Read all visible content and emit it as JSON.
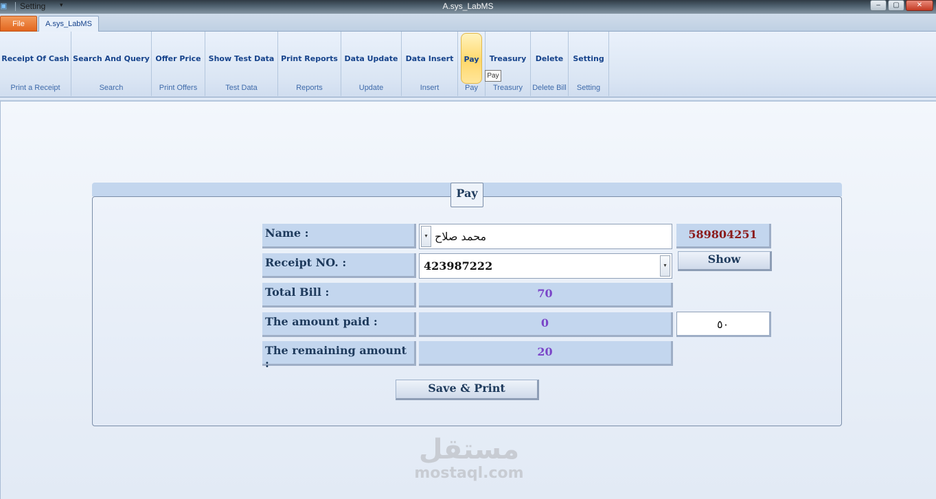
{
  "window": {
    "title": "A.sys_LabMS",
    "quick_access_label": "Setting",
    "buttons": {
      "minimize": "–",
      "restore": "▢",
      "close": "✕"
    }
  },
  "tabs": {
    "file": "File",
    "main": "A.sys_LabMS"
  },
  "ribbon": {
    "groups": [
      {
        "button": "Receipt Of Cash",
        "label": "Print a Receipt"
      },
      {
        "button": "Search And Query",
        "label": "Search"
      },
      {
        "button": "Offer Price",
        "label": "Print Offers"
      },
      {
        "button": "Show Test Data",
        "label": "Test Data"
      },
      {
        "button": "Print Reports",
        "label": "Reports"
      },
      {
        "button": "Data Update",
        "label": "Update"
      },
      {
        "button": "Data Insert",
        "label": "Insert"
      },
      {
        "button": "Pay",
        "label": "Pay",
        "active": true
      },
      {
        "button": "Treasury",
        "label": "Treasury"
      },
      {
        "button": "Delete",
        "label": "Delete Bill"
      },
      {
        "button": "Setting",
        "label": "Setting"
      }
    ],
    "tooltip": "Pay"
  },
  "form": {
    "title": "Pay",
    "name_label": "Name :",
    "name_value": "محمد صلاح",
    "id_value": "589804251",
    "receipt_label": "Receipt NO. :",
    "receipt_value": "423987222",
    "show_button": "Show",
    "total_label": "Total Bill :",
    "total_value": "70",
    "paid_label": "The amount paid :",
    "paid_value": "0",
    "paid_input": "٥٠",
    "remaining_label": "The remaining amount :",
    "remaining_value": "20",
    "save_button": "Save & Print"
  },
  "watermark": {
    "arabic": "مستقل",
    "latin": "mostaql.com"
  },
  "colors": {
    "accent": "#15428b",
    "value_text": "#7a45c8",
    "id_text": "#8b1a1a",
    "file_tab": "#e3661f"
  }
}
